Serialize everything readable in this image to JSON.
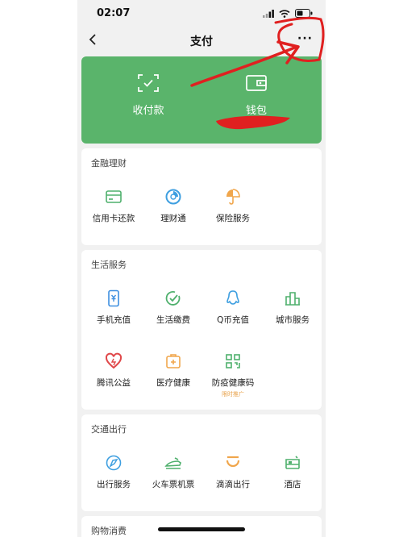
{
  "status_bar": {
    "time": "02:07"
  },
  "nav": {
    "title": "支付",
    "more": "···"
  },
  "hero": {
    "receive_pay": "收付款",
    "wallet": "钱包"
  },
  "sections": [
    {
      "title": "金融理财",
      "items": [
        {
          "label": "信用卡还款",
          "icon": "credit-card-icon"
        },
        {
          "label": "理财通",
          "icon": "wealth-icon"
        },
        {
          "label": "保险服务",
          "icon": "insurance-icon"
        }
      ]
    },
    {
      "title": "生活服务",
      "items": [
        {
          "label": "手机充值",
          "icon": "phone-topup-icon"
        },
        {
          "label": "生活缴费",
          "icon": "utility-icon"
        },
        {
          "label": "Q币充值",
          "icon": "qq-icon"
        },
        {
          "label": "城市服务",
          "icon": "city-icon"
        },
        {
          "label": "腾讯公益",
          "icon": "charity-heart-icon"
        },
        {
          "label": "医疗健康",
          "icon": "medical-icon"
        },
        {
          "label": "防疫健康码",
          "icon": "qr-code-icon",
          "tag": "限时推广"
        }
      ]
    },
    {
      "title": "交通出行",
      "items": [
        {
          "label": "出行服务",
          "icon": "travel-icon"
        },
        {
          "label": "火车票机票",
          "icon": "train-icon"
        },
        {
          "label": "滴滴出行",
          "icon": "didi-icon"
        },
        {
          "label": "酒店",
          "icon": "hotel-icon"
        }
      ]
    },
    {
      "title": "购物消费",
      "items": []
    }
  ],
  "colors": {
    "brand_green": "#5ab46b",
    "annotation_red": "#e02020"
  }
}
